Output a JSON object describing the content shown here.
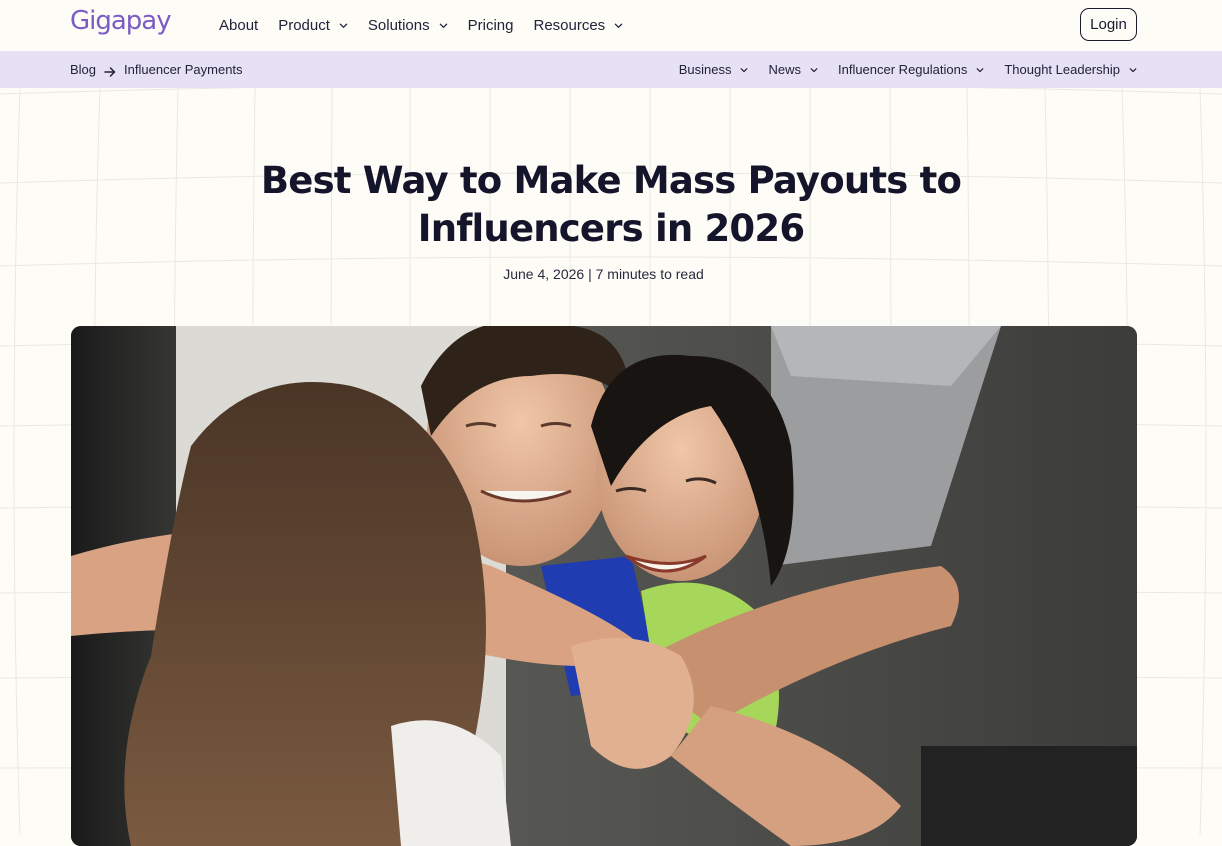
{
  "brand": {
    "logo": "Gigapay"
  },
  "nav": {
    "items": [
      {
        "label": "About",
        "has_dropdown": false
      },
      {
        "label": "Product",
        "has_dropdown": true
      },
      {
        "label": "Solutions",
        "has_dropdown": true
      },
      {
        "label": "Pricing",
        "has_dropdown": false
      },
      {
        "label": "Resources",
        "has_dropdown": true
      }
    ],
    "login_label": "Login"
  },
  "subnav": {
    "breadcrumb": {
      "root": "Blog",
      "current": "Influencer Payments"
    },
    "categories": [
      {
        "label": "Business"
      },
      {
        "label": "News"
      },
      {
        "label": "Influencer Regulations"
      },
      {
        "label": "Thought Leadership"
      }
    ]
  },
  "article": {
    "title_line1": "Best Way to Make Mass Payouts to",
    "title_line2": "Influencers in 2026",
    "date": "June 4, 2026",
    "separator": "|",
    "read_time": "7 minutes to read"
  },
  "colors": {
    "brand": "#7c5cc4",
    "subnav_bg": "#e6e1f4",
    "page_bg": "#fdfcf7"
  },
  "icons": {
    "chevron": "chevron-down-icon",
    "arrow": "arrow-right-icon"
  }
}
